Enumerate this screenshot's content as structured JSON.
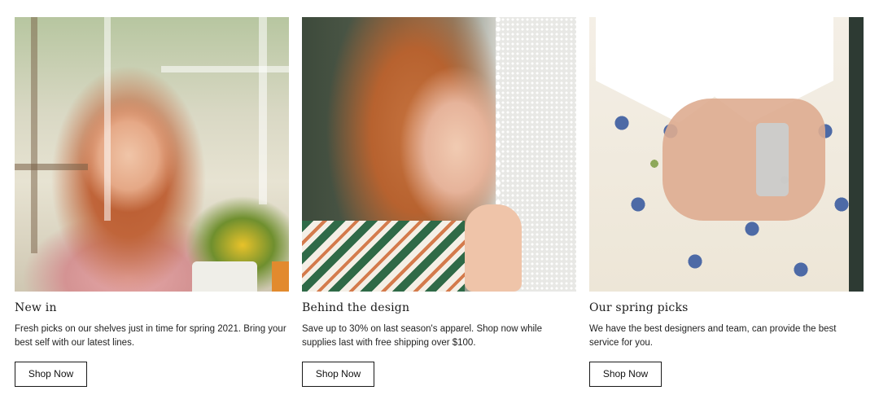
{
  "cards": [
    {
      "image_desc": "woman-in-greenhouse",
      "title": "New in",
      "description": "Fresh picks on our shelves just in time for spring 2021. Bring your best self with our latest lines.",
      "button_label": "Shop Now"
    },
    {
      "image_desc": "woman-with-lace-curtain",
      "title": "Behind the design",
      "description": "Save up to 30% on last season's apparel. Shop now while supplies last with free shipping over $100.",
      "button_label": "Shop Now"
    },
    {
      "image_desc": "floral-blouse-with-perfume",
      "title": "Our spring picks",
      "description": "We have the best designers and team, can provide the best service for you.",
      "button_label": "Shop Now"
    }
  ]
}
